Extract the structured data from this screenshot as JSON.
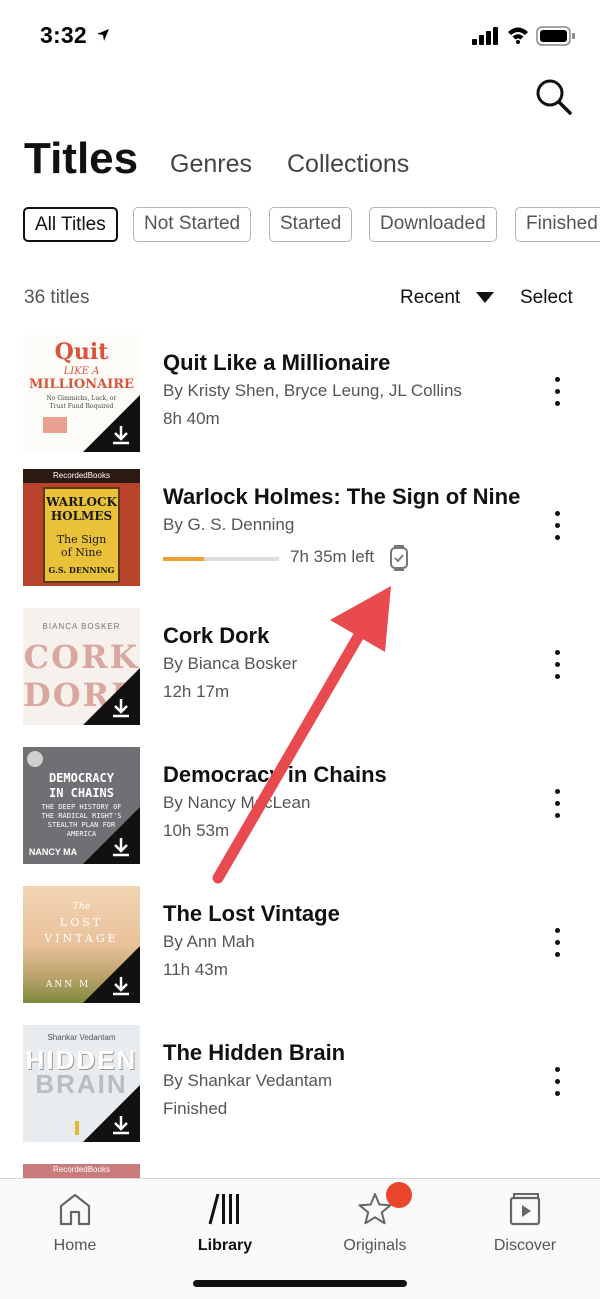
{
  "status_bar": {
    "time": "3:32"
  },
  "header": {
    "tabs": [
      {
        "label": "Titles",
        "active": true
      },
      {
        "label": "Genres",
        "active": false
      },
      {
        "label": "Collections",
        "active": false
      }
    ]
  },
  "filters": [
    {
      "label": "All Titles",
      "selected": true
    },
    {
      "label": "Not Started",
      "selected": false
    },
    {
      "label": "Started",
      "selected": false
    },
    {
      "label": "Downloaded",
      "selected": false
    },
    {
      "label": "Finished",
      "selected": false
    }
  ],
  "list_header": {
    "count": "36 titles",
    "sort": "Recent",
    "select": "Select"
  },
  "books": [
    {
      "title": "Quit Like a Millionaire",
      "author": "By Kristy Shen, Bryce Leung, JL Collins",
      "meta": "8h 40m",
      "downloaded": true,
      "cover_lines": [
        "Quit",
        "LIKE A",
        "MILLIONAIRE",
        "No Gimmicks, Luck, or",
        "Trust Fund Required"
      ]
    },
    {
      "title": "Warlock Holmes: The Sign of Nine",
      "author": "By G. S. Denning",
      "time_left": "7h 35m left",
      "progress": 0.35,
      "downloaded": false,
      "cover_lines": [
        "RecordedBooks",
        "WARLOCK",
        "HOLMES",
        "The Sign",
        "of Nine",
        "G.S. DENNING"
      ]
    },
    {
      "title": "Cork Dork",
      "author": "By Bianca Bosker",
      "meta": "12h 17m",
      "downloaded": true,
      "cover_lines": [
        "BIANCA BOSKER",
        "CORK",
        "DORK"
      ]
    },
    {
      "title": "Democracy in Chains",
      "author": "By Nancy MacLean",
      "meta": "10h 53m",
      "downloaded": true,
      "cover_lines": [
        "DEMOCRACY",
        "IN CHAINS",
        "THE DEEP HISTORY OF",
        "THE RADICAL RIGHT'S",
        "STEALTH PLAN FOR",
        "AMERICA",
        "NANCY MA"
      ]
    },
    {
      "title": "The Lost Vintage",
      "author": "By Ann Mah",
      "meta": "11h 43m",
      "downloaded": true,
      "cover_lines": [
        "The",
        "LOST",
        "VINTAGE",
        "ANN M"
      ]
    },
    {
      "title": "The Hidden Brain",
      "author": "By Shankar Vedantam",
      "meta": "Finished",
      "downloaded": true,
      "cover_lines": [
        "Shankar Vedantam",
        "HIDDEN",
        "BRAIN"
      ]
    }
  ],
  "peek_cover": {
    "text": "RecordedBooks"
  },
  "bottom_nav": [
    {
      "label": "Home",
      "icon": "home-icon",
      "active": false
    },
    {
      "label": "Library",
      "icon": "library-icon",
      "active": true
    },
    {
      "label": "Originals",
      "icon": "star-icon",
      "active": false,
      "badge": true
    },
    {
      "label": "Discover",
      "icon": "play-icon",
      "active": false
    }
  ],
  "colors": {
    "accent": "#e8452c",
    "progress": "#f0a030",
    "annotation": "#e84a4f"
  }
}
